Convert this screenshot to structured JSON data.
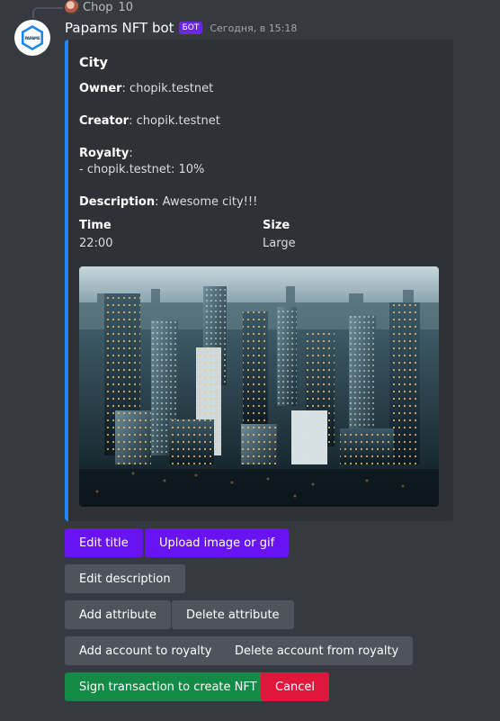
{
  "reply": {
    "username": "Chop",
    "content": "10"
  },
  "message": {
    "username": "Papams NFT bot",
    "bot_tag": "БОТ",
    "timestamp": "Сегодня, в 15:18",
    "avatar_text": "PAPAMS"
  },
  "embed": {
    "accent_color": "#1e88ff",
    "title": "City",
    "owner_label": "Owner",
    "owner_value": ": chopik.testnet",
    "creator_label": "Creator",
    "creator_value": ": chopik.testnet",
    "royalty_label": "Royalty",
    "royalty_colon": ":",
    "royalty_line": "- chopik.testnet: 10%",
    "description_label": "Description",
    "description_value": ": Awesome city!!!",
    "inline_fields": [
      {
        "name": "Time",
        "value": "22:00"
      },
      {
        "name": "Size",
        "value": "Large"
      }
    ]
  },
  "buttons": {
    "edit_title": "Edit title",
    "upload_image": "Upload image or gif",
    "edit_description": "Edit description",
    "add_attribute": "Add attribute",
    "delete_attribute": "Delete attribute",
    "add_account_royalty": "Add account to royalty",
    "delete_account_royalty": "Delete account from royalty",
    "sign_transaction": "Sign transaction to create NFT",
    "cancel": "Cancel"
  },
  "colors": {
    "primary": "#6a13f2",
    "secondary": "#4f545c",
    "success": "#138a46",
    "danger": "#e1163c"
  }
}
